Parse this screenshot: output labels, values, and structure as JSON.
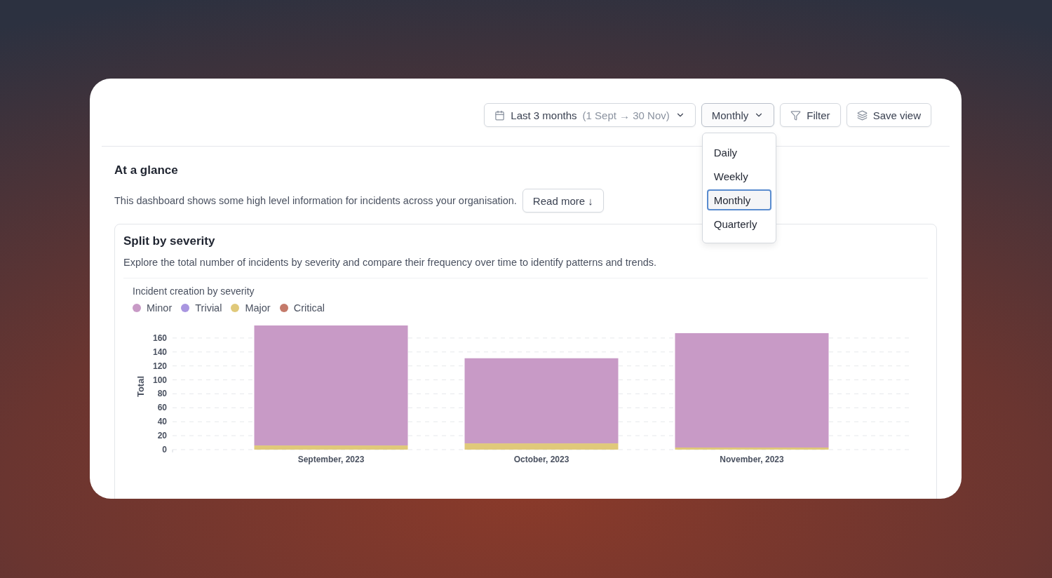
{
  "toolbar": {
    "date_range": {
      "label": "Last 3 months",
      "detail": "(1 Sept → 30 Nov)"
    },
    "granularity": {
      "label": "Monthly",
      "expanded": true
    },
    "filter": {
      "label": "Filter"
    },
    "save_view": {
      "label": "Save view"
    }
  },
  "granularity_menu": [
    {
      "label": "Daily",
      "selected": false
    },
    {
      "label": "Weekly",
      "selected": false
    },
    {
      "label": "Monthly",
      "selected": true
    },
    {
      "label": "Quarterly",
      "selected": false
    }
  ],
  "intro": {
    "title": "At a glance",
    "text": "This dashboard shows some high level information for incidents across your organisation.",
    "read_more": "Read more ↓"
  },
  "panel": {
    "title": "Split by severity",
    "description": "Explore the total number of incidents by severity and compare their frequency over time to identify patterns and trends.",
    "chart_data": {
      "type": "bar",
      "title": "Incident creation by severity",
      "ylabel": "Total",
      "stacked": true,
      "categories": [
        "September, 2023",
        "October, 2023",
        "November, 2023"
      ],
      "ylim": [
        0,
        180
      ],
      "grid": true,
      "legend": "top-left",
      "yticks": [
        0,
        20,
        40,
        60,
        80,
        100,
        120,
        140,
        160
      ],
      "series": [
        {
          "name": "Minor",
          "color": "#c89ac6",
          "values": [
            172,
            122,
            164
          ]
        },
        {
          "name": "Trivial",
          "color": "#a996e0",
          "values": [
            0,
            0,
            0
          ]
        },
        {
          "name": "Major",
          "color": "#e0c97a",
          "values": [
            6,
            9,
            3
          ]
        },
        {
          "name": "Critical",
          "color": "#c47a6a",
          "values": [
            0,
            0,
            0
          ]
        }
      ]
    }
  }
}
